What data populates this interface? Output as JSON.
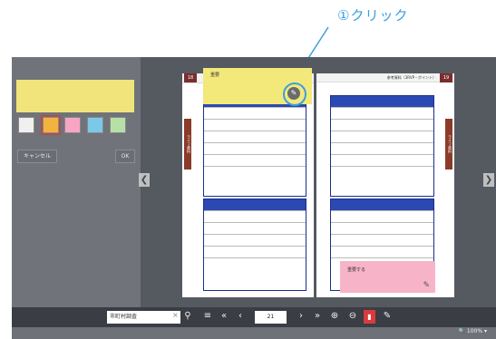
{
  "callout": {
    "text": "①クリック"
  },
  "sticky_note": {
    "label": "重要"
  },
  "pink_note": {
    "label": "重要する"
  },
  "left_panel": {
    "cancel": "キャンセル",
    "ok": "OK",
    "colors": [
      "#f0f0f0",
      "#f0b43f",
      "#f7a5c2",
      "#7cc8e8",
      "#b7e0a8"
    ],
    "selected_color_index": 1
  },
  "pages": {
    "left_num": "18",
    "right_num": "19",
    "right_header": "参考資料（3RVP・ポイント）",
    "left_side_tab": "ライフ資料",
    "right_side_tab": "ライフ資料"
  },
  "toolbar": {
    "search_value": "市町村調査",
    "page_value": "21"
  },
  "status": {
    "zoom": "100%"
  }
}
